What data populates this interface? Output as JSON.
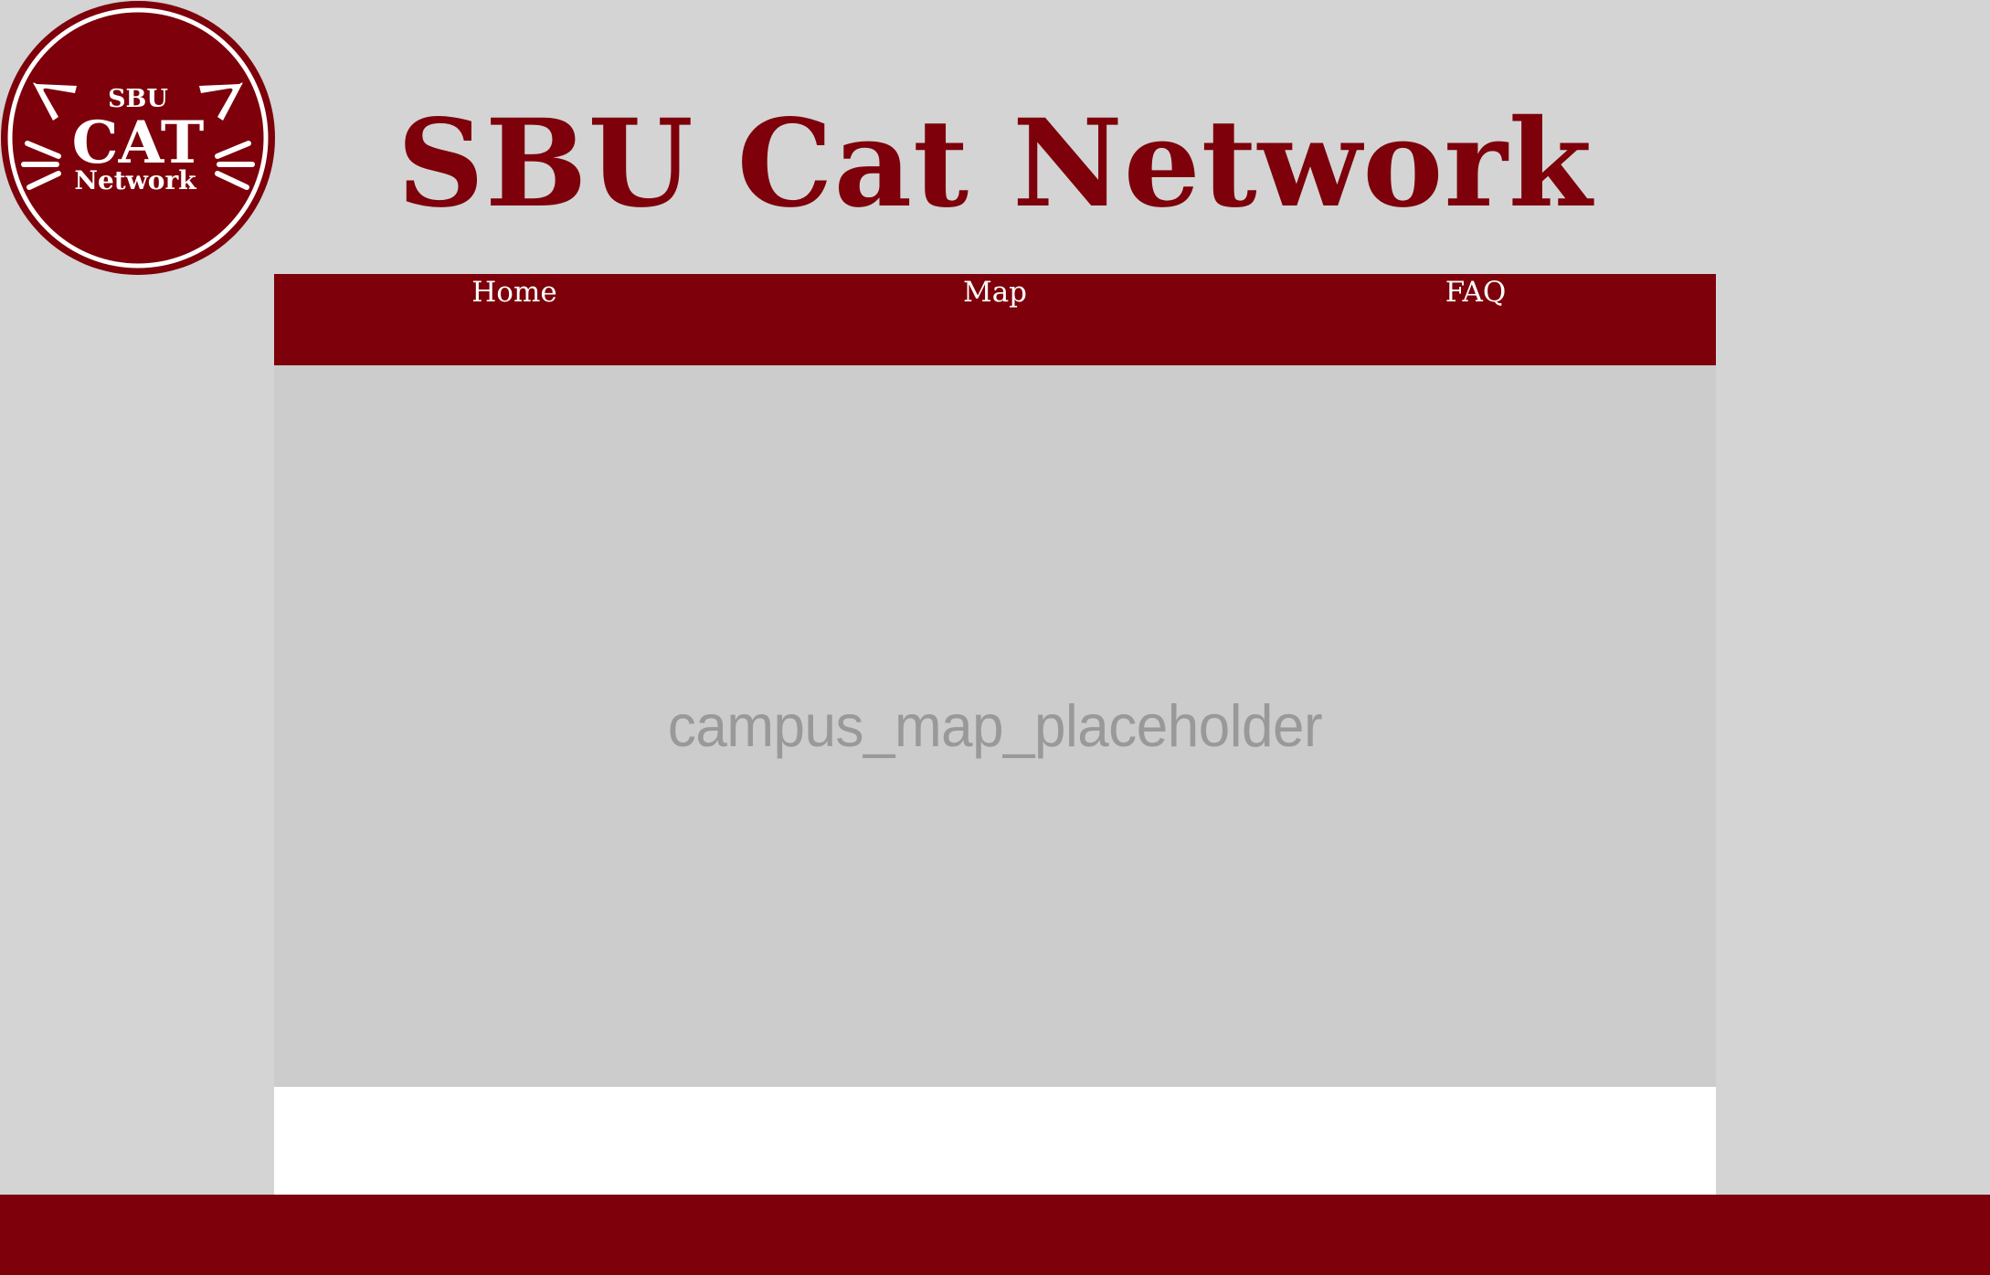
{
  "logo": {
    "line1": "SBU",
    "line2": "CAT",
    "line3": "Network"
  },
  "header": {
    "title": "SBU Cat Network"
  },
  "nav": {
    "items": [
      {
        "label": "Home"
      },
      {
        "label": "Map"
      },
      {
        "label": "FAQ"
      }
    ]
  },
  "map": {
    "placeholder_text": "campus_map_placeholder"
  },
  "colors": {
    "brand": "#7d000a",
    "page_background": "#d4d4d4",
    "map_background": "#cccccc",
    "placeholder_text": "#999999",
    "content_background": "#ffffff"
  }
}
